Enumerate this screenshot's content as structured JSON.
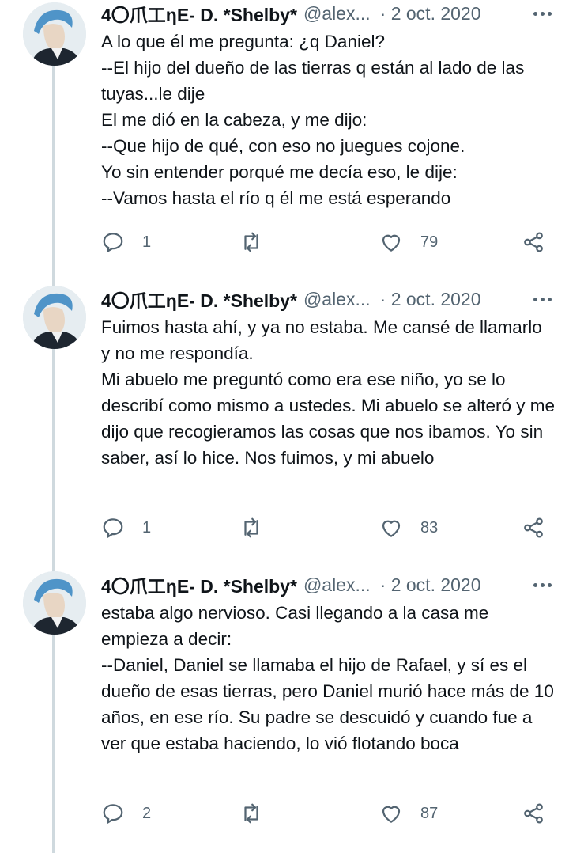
{
  "tweets": [
    {
      "author": "4〇爪工ƞE- D. *Shelby*",
      "handle": "@alex...",
      "date": "· 2 oct. 2020",
      "text": "A lo que él me pregunta: ¿q Daniel?\n--El hijo del dueño de las tierras q están al lado de las tuyas...le dije\nEl me dió en la cabeza, y me dijo:\n--Que hijo de qué, con eso no juegues cojone.\nYo sin entender porqué me decía eso, le dije:\n--Vamos hasta el río q él me está esperando",
      "replies": "1",
      "retweets": "",
      "likes": "79"
    },
    {
      "author": "4〇爪工ƞE- D. *Shelby*",
      "handle": "@alex...",
      "date": "· 2 oct. 2020",
      "text": "Fuimos hasta ahí, y ya no estaba. Me cansé de llamarlo y no me respondía.\nMi abuelo me preguntó como era ese niño, yo se lo describí como mismo a ustedes. Mi abuelo se alteró y me dijo que recogieramos las cosas que nos ibamos. Yo sin saber, así lo hice. Nos fuimos, y mi abuelo",
      "replies": "1",
      "retweets": "",
      "likes": "83"
    },
    {
      "author": "4〇爪工ƞE- D. *Shelby*",
      "handle": "@alex...",
      "date": "· 2 oct. 2020",
      "text": "estaba algo nervioso. Casi llegando a la casa me empieza a decir:\n--Daniel, Daniel se llamaba el hijo de Rafael, y sí es el dueño de esas tierras, pero Daniel murió hace más de 10 años, en ese río. Su padre se descuidó y cuando fue a ver que estaba haciendo, lo vió flotando boca",
      "replies": "2",
      "retweets": "",
      "likes": "87"
    }
  ],
  "icons": {
    "reply": "reply-icon",
    "retweet": "retweet-icon",
    "like": "heart-icon",
    "share": "share-icon",
    "more": "more-icon"
  },
  "colors": {
    "text": "#0f1419",
    "secondary": "#536471",
    "thread_line": "#cfd9de"
  }
}
